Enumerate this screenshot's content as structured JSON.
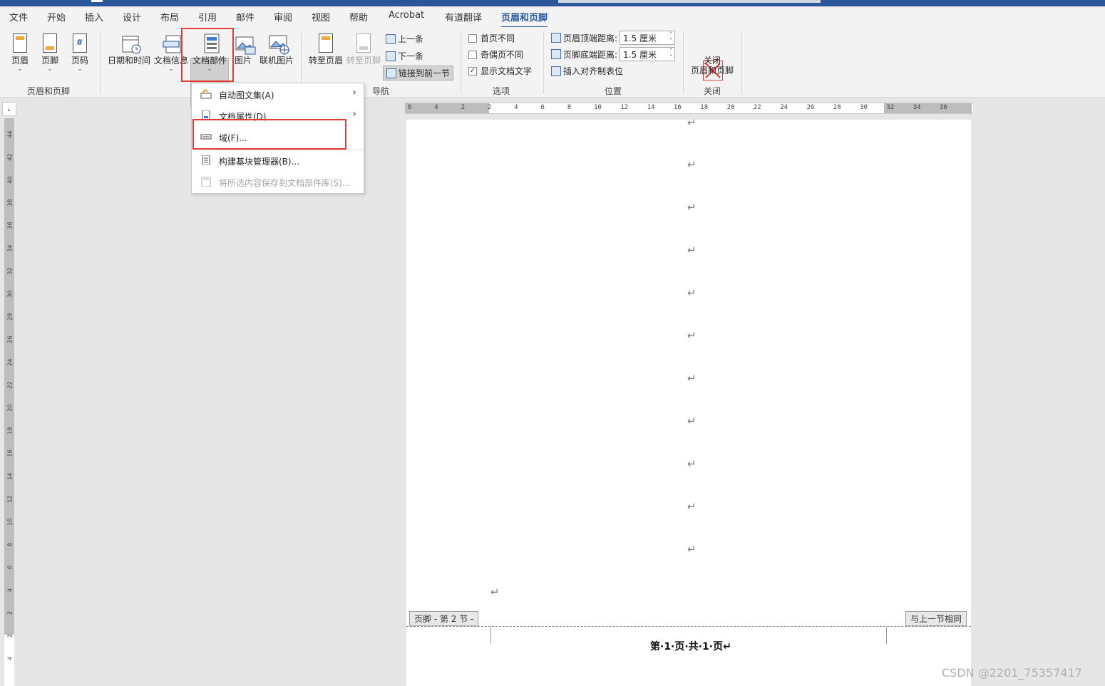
{
  "tabs": [
    "文件",
    "开始",
    "插入",
    "设计",
    "布局",
    "引用",
    "邮件",
    "审阅",
    "视图",
    "帮助",
    "Acrobat",
    "有道翻译",
    "页眉和页脚"
  ],
  "ribbon": {
    "header_footer_group": {
      "label": "页眉和页脚",
      "buttons": [
        "页眉",
        "页脚",
        "页码"
      ]
    },
    "insert_group": {
      "buttons": [
        "日期和时间",
        "文档信息",
        "文档部件",
        "图片",
        "联机图片"
      ]
    },
    "nav_group": {
      "label": "导航",
      "goto_header": "转至页眉",
      "goto_footer": "转至页脚",
      "prev": "上一条",
      "next": "下一条",
      "link_prev": "链接到前一节"
    },
    "options_group": {
      "label": "选项",
      "different_first": "首页不同",
      "different_odd_even": "奇偶页不同",
      "show_doc_text": "显示文档文字"
    },
    "position_group": {
      "label": "位置",
      "header_top": "页眉顶端距离:",
      "footer_bottom": "页脚底端距离:",
      "header_value": "1.5 厘米",
      "footer_value": "1.5 厘米",
      "insert_align_tab": "插入对齐制表位"
    },
    "close_group": {
      "label": "关闭",
      "close_line1": "关闭",
      "close_line2": "页眉和页脚"
    }
  },
  "menu": {
    "items": [
      "自动图文集(A)",
      "文档属性(D)",
      "域(F)...",
      "构建基块管理器(B)...",
      "将所选内容保存到文档部件库(S)..."
    ]
  },
  "ruler": {
    "h_numbers": [
      "6",
      "4",
      "2",
      "2",
      "4",
      "6",
      "8",
      "10",
      "12",
      "14",
      "16",
      "18",
      "20",
      "22",
      "24",
      "26",
      "28",
      "30",
      "32",
      "34",
      "36"
    ],
    "v_numbers": [
      "44",
      "42",
      "40",
      "38",
      "36",
      "34",
      "32",
      "30",
      "28",
      "26",
      "24",
      "22",
      "20",
      "18",
      "16",
      "14",
      "12",
      "10",
      "8",
      "6",
      "4",
      "2",
      "2",
      "4"
    ]
  },
  "document": {
    "paragraph_mark": "↵",
    "footer_tag": "页脚 - 第 2 节 -",
    "same_as_prev_tag": "与上一节相同",
    "footer_text": "第·1·页·共·1·页↵"
  },
  "watermark": "CSDN @2201_75357417"
}
